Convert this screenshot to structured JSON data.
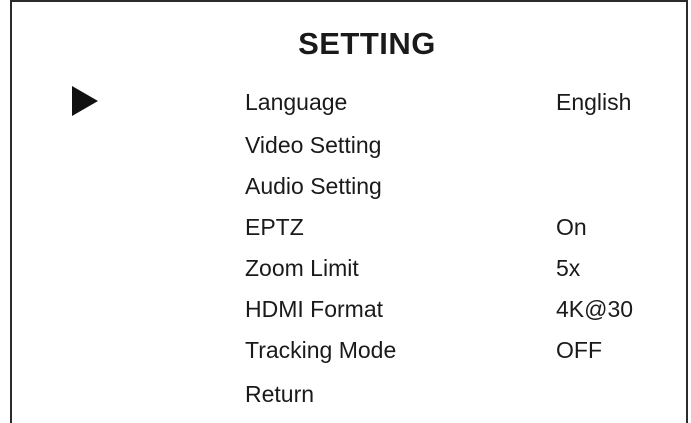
{
  "menu": {
    "title": "SETTING",
    "selected_index": 0,
    "items": [
      {
        "label": "Language",
        "value": "English"
      },
      {
        "label": "Video Setting",
        "value": ""
      },
      {
        "label": "Audio Setting",
        "value": ""
      },
      {
        "label": "EPTZ",
        "value": "On"
      },
      {
        "label": "Zoom Limit",
        "value": "5x"
      },
      {
        "label": "HDMI Format",
        "value": "4K@30"
      },
      {
        "label": "Tracking Mode",
        "value": "OFF"
      },
      {
        "label": "Return",
        "value": ""
      }
    ]
  },
  "icons": {
    "cursor": "play-triangle-icon"
  }
}
